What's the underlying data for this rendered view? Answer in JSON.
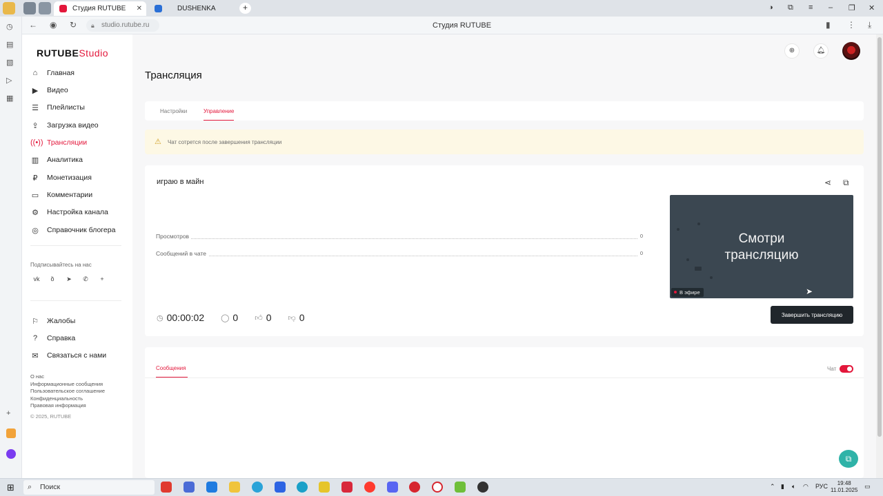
{
  "browser": {
    "active_tab": "Студия RUTUBE",
    "second_tab": "DUSHENKA",
    "url": "studio.rutube.ru",
    "page_title": "Студия RUTUBE"
  },
  "brand": {
    "logo_main": "RUTUBE",
    "logo_studio": "Studio",
    "accent": "#e3173b"
  },
  "sidebar": {
    "items": [
      {
        "label": "Главная",
        "icon": "home-icon"
      },
      {
        "label": "Видео",
        "icon": "video-icon"
      },
      {
        "label": "Плейлисты",
        "icon": "playlist-icon"
      },
      {
        "label": "Загрузка видео",
        "icon": "upload-icon"
      },
      {
        "label": "Трансляции",
        "icon": "broadcast-icon",
        "active": true
      },
      {
        "label": "Аналитика",
        "icon": "analytics-icon"
      },
      {
        "label": "Монетизация",
        "icon": "monetization-icon"
      },
      {
        "label": "Комментарии",
        "icon": "comments-icon"
      },
      {
        "label": "Настройка канала",
        "icon": "gear-icon"
      },
      {
        "label": "Справочник блогера",
        "icon": "book-icon"
      }
    ],
    "subscribe_label": "Подписывайтесь на нас",
    "bottom_items": [
      {
        "label": "Жалобы",
        "icon": "flag-icon"
      },
      {
        "label": "Справка",
        "icon": "help-icon"
      },
      {
        "label": "Связаться с нами",
        "icon": "mail-icon"
      }
    ],
    "footer_links": [
      "О нас",
      "Информационные сообщения",
      "Пользовательское соглашение",
      "Конфиденциальность",
      "Правовая информация"
    ],
    "copyright": "© 2025, RUTUBE"
  },
  "main": {
    "title": "Трансляция",
    "tabs": [
      {
        "label": "Настройки"
      },
      {
        "label": "Управление",
        "active": true
      }
    ],
    "notice": "Чат сотрется после завершения трансляции",
    "stream": {
      "name": "играю в майн",
      "stats": [
        {
          "label": "Просмотров",
          "value": "0"
        },
        {
          "label": "Сообщений в чате",
          "value": "0"
        }
      ],
      "preview_line1": "Смотри",
      "preview_line2": "трансляцию",
      "live_label": "В эфире",
      "duration": "00:00:02",
      "viewers": "0",
      "likes": "0",
      "dislikes": "0",
      "end_button": "Завершить трансляцию"
    },
    "chat": {
      "tab_label": "Сообщения",
      "toggle_label": "Чат",
      "toggle_on": true
    }
  },
  "taskbar": {
    "search_placeholder": "Поиск",
    "lang": "РУС",
    "time": "19:48",
    "date": "11.01.2025"
  }
}
